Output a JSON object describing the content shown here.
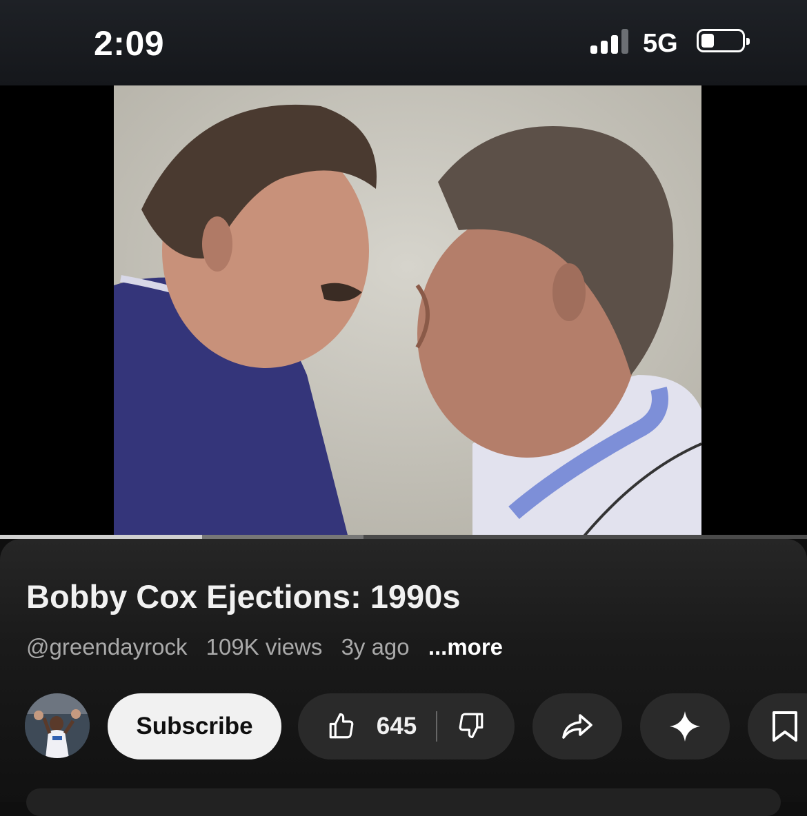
{
  "status_bar": {
    "time": "2:09",
    "network": "5G",
    "icons": [
      "signal-bars-icon",
      "battery-icon"
    ]
  },
  "player": {
    "progress": 0.25,
    "buffered": 0.45
  },
  "video": {
    "title": "Bobby Cox Ejections: 1990s",
    "channel": "@greendayrock",
    "views": "109K views",
    "age": "3y ago",
    "more_label": "...more"
  },
  "actions": {
    "subscribe_label": "Subscribe",
    "like_count": "645",
    "icons": [
      "thumbs-up-icon",
      "thumbs-down-icon",
      "share-icon",
      "sparkle-icon",
      "bookmark-icon"
    ]
  },
  "colors": {
    "background": "#0f0f0f",
    "subscribe_bg": "#f1f1f1",
    "pill_bg": "#2a2a2a"
  }
}
